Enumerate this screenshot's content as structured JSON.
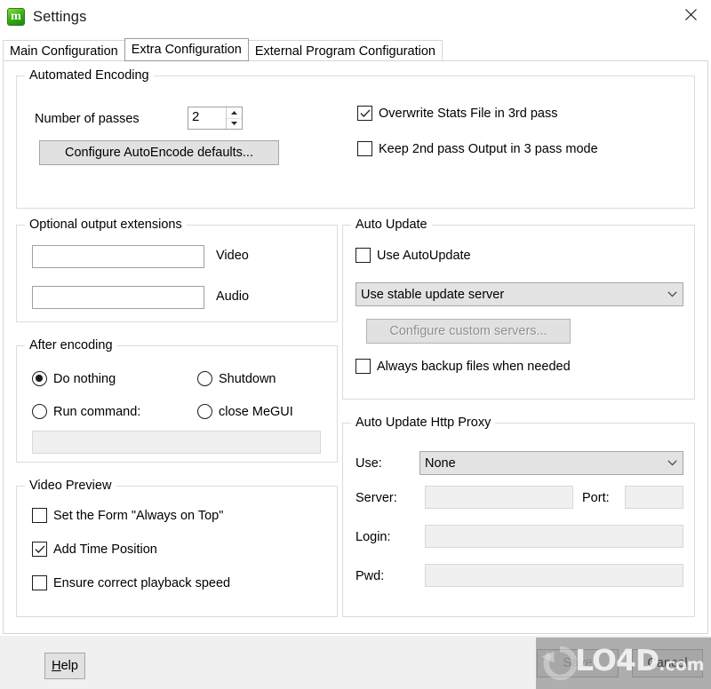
{
  "window": {
    "title": "Settings",
    "icon": "megui-app-icon",
    "icon_glyph": "m",
    "close_label": "✕",
    "accent_green": "#36b016"
  },
  "tabs": [
    {
      "label": "Main Configuration",
      "selected": false
    },
    {
      "label": "Extra Configuration",
      "selected": true
    },
    {
      "label": "External Program Configuration",
      "selected": false
    }
  ],
  "automated_encoding": {
    "title": "Automated Encoding",
    "passes_label": "Number of passes",
    "passes_value": "2",
    "configure_autoencode_button": "Configure AutoEncode defaults...",
    "overwrite_stats": {
      "label": "Overwrite Stats File in 3rd pass",
      "checked": true
    },
    "keep_2nd_pass": {
      "label": "Keep 2nd pass Output in 3 pass mode",
      "checked": false
    }
  },
  "optional_output_extensions": {
    "title": "Optional output extensions",
    "video_value": "",
    "video_label": "Video",
    "audio_value": "",
    "audio_label": "Audio"
  },
  "after_encoding": {
    "title": "After encoding",
    "options": [
      {
        "label": "Do nothing",
        "selected": true
      },
      {
        "label": "Shutdown",
        "selected": false
      },
      {
        "label": "Run command:",
        "selected": false
      },
      {
        "label": "close MeGUI",
        "selected": false
      }
    ],
    "command_value": ""
  },
  "video_preview": {
    "title": "Video Preview",
    "items": [
      {
        "label": "Set the Form \"Always on Top\"",
        "checked": false
      },
      {
        "label": "Add Time Position",
        "checked": true
      },
      {
        "label": "Ensure correct playback speed",
        "checked": false
      }
    ]
  },
  "auto_update": {
    "title": "Auto Update",
    "use_autoupdate": {
      "label": "Use AutoUpdate",
      "checked": false
    },
    "server_combo_value": "Use stable update server",
    "configure_servers_button": "Configure custom servers...",
    "always_backup": {
      "label": "Always backup files when needed",
      "checked": false
    }
  },
  "http_proxy": {
    "title": "Auto Update Http Proxy",
    "use_label": "Use:",
    "use_value": "None",
    "server_label": "Server:",
    "server_value": "",
    "port_label": "Port:",
    "port_value": "",
    "login_label": "Login:",
    "login_value": "",
    "pwd_label": "Pwd:",
    "pwd_value": ""
  },
  "footer": {
    "help_accel": "H",
    "help_rest": "elp",
    "save_label": "Save",
    "cancel_label": "Cancel"
  },
  "watermark": {
    "text": "LO4D",
    "suffix": ".com"
  }
}
